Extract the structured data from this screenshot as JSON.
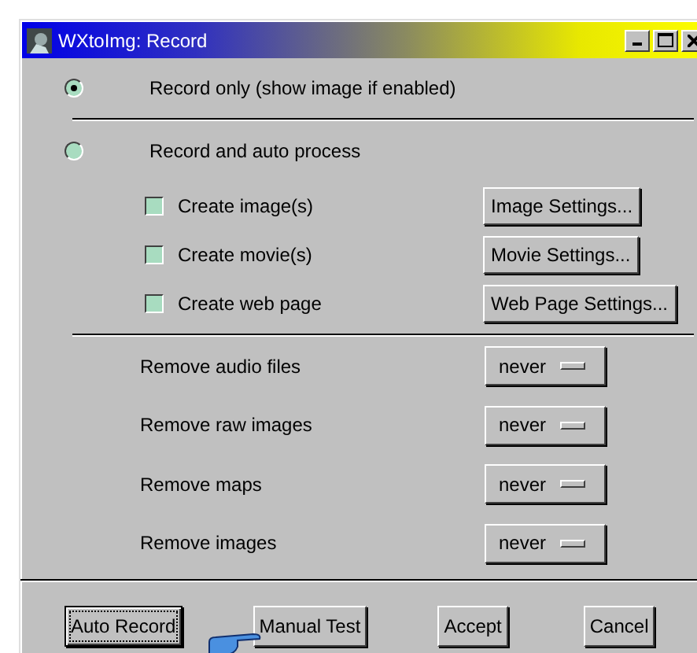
{
  "window": {
    "title": "WXtoImg: Record"
  },
  "modes": [
    {
      "label": "Record only (show image if enabled)",
      "selected": true
    },
    {
      "label": "Record and auto process",
      "selected": false
    }
  ],
  "outputs": [
    {
      "label": "Create image(s)",
      "checked": false,
      "button": "Image Settings..."
    },
    {
      "label": "Create movie(s)",
      "checked": false,
      "button": "Movie Settings..."
    },
    {
      "label": "Create web page",
      "checked": false,
      "button": "Web Page Settings..."
    }
  ],
  "removals": [
    {
      "label": "Remove audio files",
      "value": "never"
    },
    {
      "label": "Remove raw images",
      "value": "never"
    },
    {
      "label": "Remove maps",
      "value": "never"
    },
    {
      "label": "Remove images",
      "value": "never"
    }
  ],
  "buttons": [
    {
      "label": "Auto Record",
      "focused": true
    },
    {
      "label": "Manual Test",
      "focused": false
    },
    {
      "label": "Accept",
      "focused": false
    },
    {
      "label": "Cancel",
      "focused": false
    }
  ]
}
